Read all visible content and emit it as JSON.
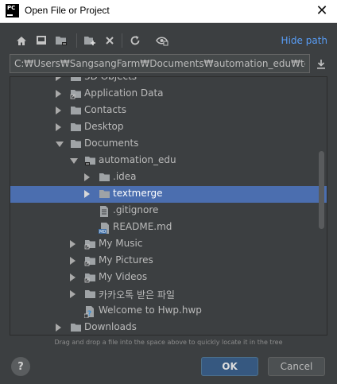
{
  "window": {
    "app_icon_text": "PC",
    "title": "Open File or Project",
    "close_glyph": "✕"
  },
  "toolbar": {
    "buttons": [
      {
        "name": "home-icon"
      },
      {
        "name": "desktop-icon"
      },
      {
        "name": "project-folder-icon"
      },
      {
        "name": "new-folder-icon"
      },
      {
        "name": "delete-icon"
      },
      {
        "name": "refresh-icon"
      },
      {
        "name": "show-hidden-icon"
      }
    ],
    "hide_path_label": "Hide path"
  },
  "path": {
    "value": "C:₩Users₩SangsangFarm₩Documents₩automation_edu₩textmerge"
  },
  "tree": {
    "rows": [
      {
        "label": "3D Objects",
        "arrow": "right",
        "icon": "folder",
        "depth": 0
      },
      {
        "label": "Application Data",
        "arrow": "right",
        "icon": "folder-link",
        "depth": 0
      },
      {
        "label": "Contacts",
        "arrow": "right",
        "icon": "folder",
        "depth": 0
      },
      {
        "label": "Desktop",
        "arrow": "right",
        "icon": "folder",
        "depth": 0
      },
      {
        "label": "Documents",
        "arrow": "down",
        "icon": "folder",
        "depth": 0
      },
      {
        "label": "automation_edu",
        "arrow": "down",
        "icon": "folder-project",
        "depth": 1
      },
      {
        "label": ".idea",
        "arrow": "right",
        "icon": "folder",
        "depth": 2
      },
      {
        "label": "textmerge",
        "arrow": "right",
        "icon": "folder",
        "depth": 2,
        "selected": true
      },
      {
        "label": ".gitignore",
        "arrow": "none",
        "icon": "file-text",
        "depth": 2
      },
      {
        "label": "README.md",
        "arrow": "none",
        "icon": "file-md",
        "depth": 2
      },
      {
        "label": "My Music",
        "arrow": "right",
        "icon": "folder-link",
        "depth": 1
      },
      {
        "label": "My Pictures",
        "arrow": "right",
        "icon": "folder-link",
        "depth": 1
      },
      {
        "label": "My Videos",
        "arrow": "right",
        "icon": "folder-link",
        "depth": 1
      },
      {
        "label": "카카오톡 받은 파일",
        "arrow": "right",
        "icon": "folder",
        "depth": 1
      },
      {
        "label": "Welcome to Hwp.hwp",
        "arrow": "none",
        "icon": "file-unknown",
        "depth": 1
      },
      {
        "label": "Downloads",
        "arrow": "right",
        "icon": "folder",
        "depth": 0
      }
    ]
  },
  "hint": "Drag and drop a file into the space above to quickly locate it in the tree",
  "footer": {
    "help_glyph": "?",
    "ok_label": "OK",
    "cancel_label": "Cancel"
  },
  "colors": {
    "background": "#3c3f41",
    "selection": "#4b6eaf",
    "link": "#589df6",
    "ok_button": "#365880"
  }
}
